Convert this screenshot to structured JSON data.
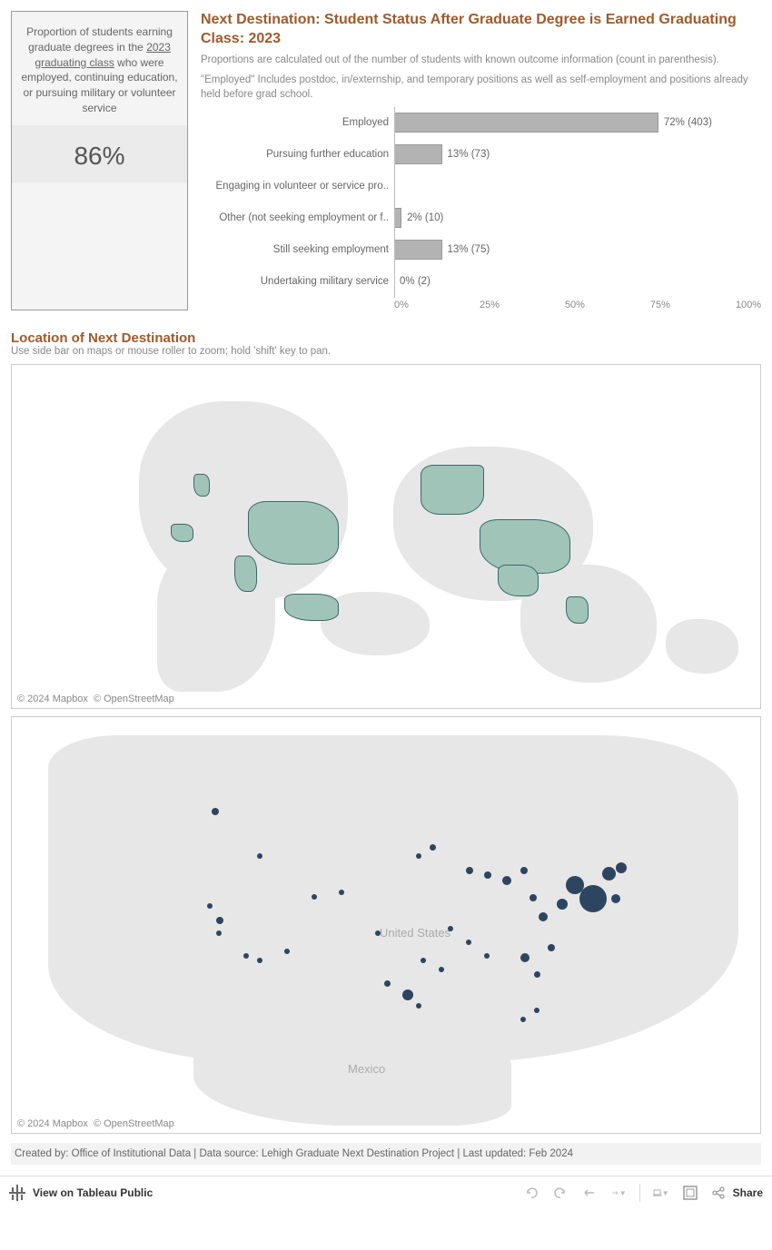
{
  "stat_box": {
    "line1": "Proportion of students earning graduate degrees in the ",
    "class_text": "2023 graduating class",
    "line2": "  who were employed, continuing education, or pursuing military or volunteer service",
    "value": "86%"
  },
  "chart_title": "Next Destination: Student Status After Graduate Degree is Earned Graduating Class: 2023",
  "chart_sub1": "Proportions are calculated out of the number of students with known outcome information (count in parenthesis).",
  "chart_sub2": "\"Employed\" Includes postdoc, in/externship, and temporary positions as well as self-employment and positions already held before grad school.",
  "chart_data": {
    "type": "bar",
    "xlim": [
      0,
      100
    ],
    "xticks": [
      "0%",
      "25%",
      "50%",
      "75%",
      "100%"
    ],
    "categories": [
      "Employed",
      "Pursuing further education",
      "Engaging in volunteer or service pro..",
      "Other (not seeking employment or f..",
      "Still seeking employment",
      "Undertaking military service"
    ],
    "values": [
      72,
      13,
      0,
      2,
      13,
      0
    ],
    "counts": [
      403,
      73,
      0,
      10,
      75,
      2
    ],
    "labels": [
      "72% (403)",
      "13% (73)",
      "",
      "2% (10)",
      "13% (75)",
      "0% (2)"
    ]
  },
  "loc_title": "Location of Next Destination",
  "loc_sub": "Use side bar on maps or mouse roller to zoom; hold 'shift' key to pan.",
  "map_attrib1": "© 2024 Mapbox",
  "map_attrib2": "© OpenStreetMap",
  "usa_label": "United States",
  "mex_label": "Mexico",
  "footer": "Created by: Office of Institutional Data | Data source: Lehigh Graduate Next Destination Project | Last updated: Feb 2024",
  "toolbar": {
    "view": "View on Tableau Public",
    "share": "Share"
  }
}
